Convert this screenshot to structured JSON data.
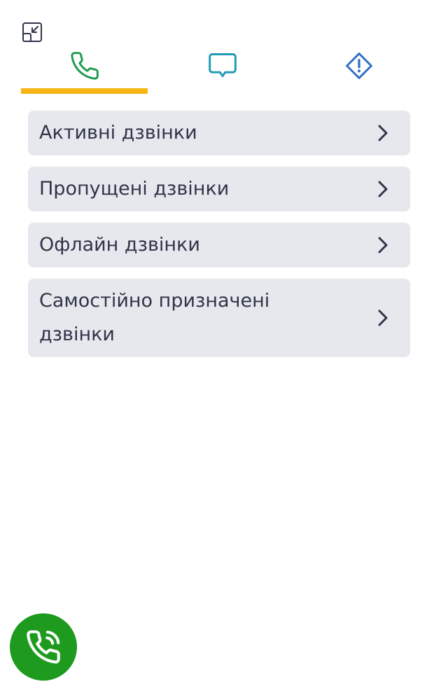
{
  "toolbar": {
    "minimize_icon": "minimize-window-icon"
  },
  "tabs": [
    {
      "id": "calls",
      "icon": "phone-icon",
      "color": "#1e9b50",
      "active": true
    },
    {
      "id": "chat",
      "icon": "chat-bubble-icon",
      "color": "#1f9ab5",
      "active": false
    },
    {
      "id": "alerts",
      "icon": "warning-diamond-icon",
      "color": "#2f6fc4",
      "active": false
    }
  ],
  "active_tab_indicator_color": "#f7b516",
  "list": {
    "items": [
      {
        "label": "Активні дзвінки"
      },
      {
        "label": "Пропущені дзвінки"
      },
      {
        "label": "Офлайн дзвінки"
      },
      {
        "label": "Самостійно призначені дзвінки"
      }
    ],
    "background": "#e7e8ee"
  },
  "fab": {
    "icon": "phone-calling-icon",
    "color": "#1e9b1e"
  }
}
